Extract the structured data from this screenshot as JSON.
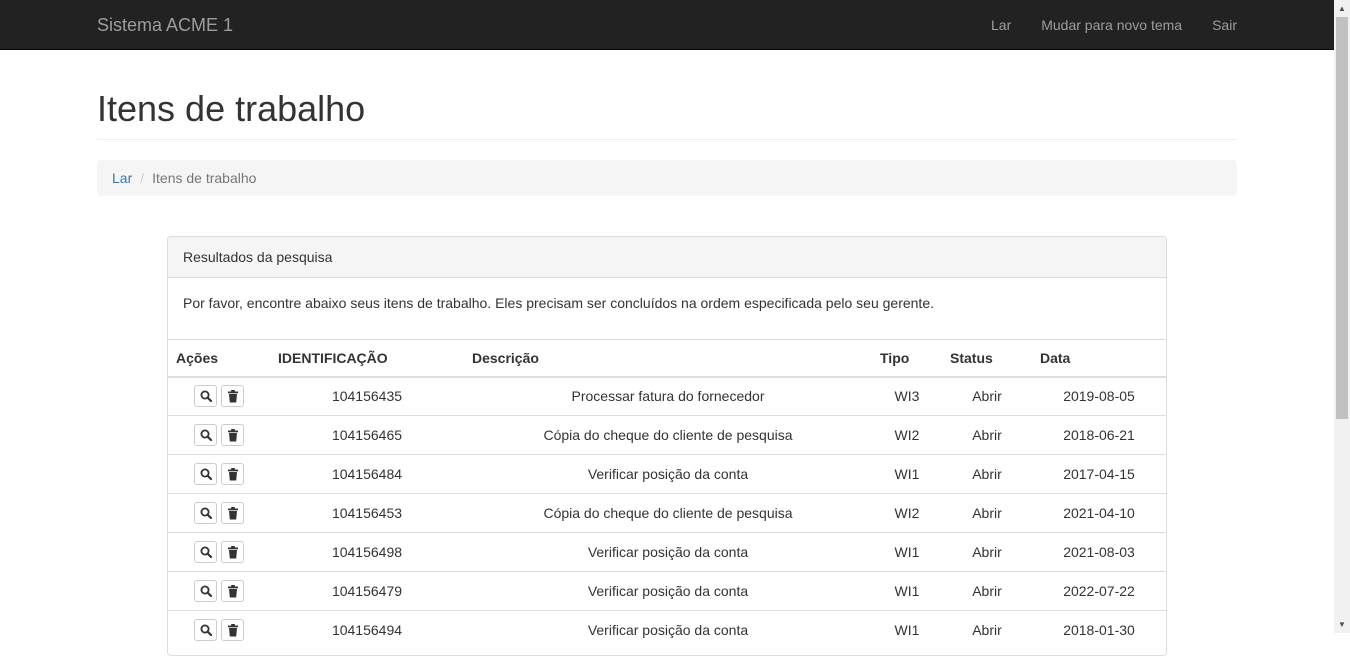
{
  "navbar": {
    "brand": "Sistema ACME 1",
    "links": [
      "Lar",
      "Mudar para novo tema",
      "Sair"
    ]
  },
  "page": {
    "title": "Itens de trabalho"
  },
  "breadcrumb": {
    "home": "Lar",
    "separator": "/",
    "current": "Itens de trabalho"
  },
  "panel": {
    "heading": "Resultados da pesquisa",
    "body": "Por favor, encontre abaixo seus itens de trabalho. Eles precisam ser concluídos na ordem especificada pelo seu gerente."
  },
  "table": {
    "headers": [
      "Ações",
      "IDENTIFICAÇÃO",
      "Descrição",
      "Tipo",
      "Status",
      "Data"
    ],
    "action_icons": [
      "search-icon",
      "trash-icon"
    ],
    "rows": [
      {
        "id": "104156435",
        "descricao": "Processar fatura do fornecedor",
        "tipo": "WI3",
        "status": "Abrir",
        "data": "2019-08-05"
      },
      {
        "id": "104156465",
        "descricao": "Cópia do cheque do cliente de pesquisa",
        "tipo": "WI2",
        "status": "Abrir",
        "data": "2018-06-21"
      },
      {
        "id": "104156484",
        "descricao": "Verificar posição da conta",
        "tipo": "WI1",
        "status": "Abrir",
        "data": "2017-04-15"
      },
      {
        "id": "104156453",
        "descricao": "Cópia do cheque do cliente de pesquisa",
        "tipo": "WI2",
        "status": "Abrir",
        "data": "2021-04-10"
      },
      {
        "id": "104156498",
        "descricao": "Verificar posição da conta",
        "tipo": "WI1",
        "status": "Abrir",
        "data": "2021-08-03"
      },
      {
        "id": "104156479",
        "descricao": "Verificar posição da conta",
        "tipo": "WI1",
        "status": "Abrir",
        "data": "2022-07-22"
      },
      {
        "id": "104156494",
        "descricao": "Verificar posição da conta",
        "tipo": "WI1",
        "status": "Abrir",
        "data": "2018-01-30"
      }
    ]
  },
  "colors": {
    "navbar_bg": "#222222",
    "navbar_text": "#9d9d9d",
    "link": "#337ab7",
    "border": "#dddddd"
  }
}
